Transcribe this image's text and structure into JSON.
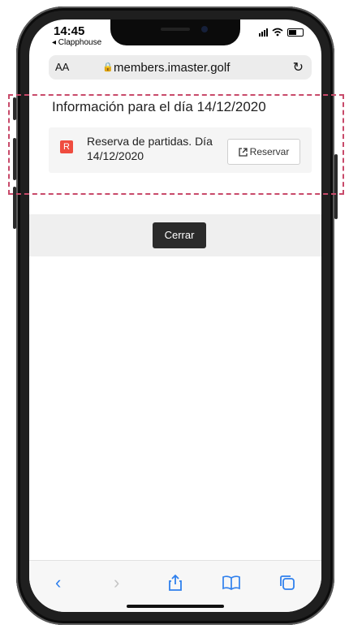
{
  "status_bar": {
    "time": "14:45",
    "back_app": "◂ Clapphouse"
  },
  "browser": {
    "aa_label": "AA",
    "url": "members.imaster.golf",
    "reload_icon": "reload-icon",
    "lock_icon": "lock-icon"
  },
  "modal": {
    "title": "Información para el día 14/12/2020",
    "event": {
      "badge": "R",
      "text": "Reserva de partidas. Día 14/12/2020",
      "reserve_label": "Reservar"
    },
    "close_label": "Cerrar"
  },
  "toolbar": {
    "icons": [
      "back-icon",
      "forward-icon",
      "share-icon",
      "bookmarks-icon",
      "tabs-icon"
    ]
  },
  "colors": {
    "badge": "#ef4c3f",
    "accent": "#2f80ed",
    "highlight_border": "#c84a6a"
  }
}
